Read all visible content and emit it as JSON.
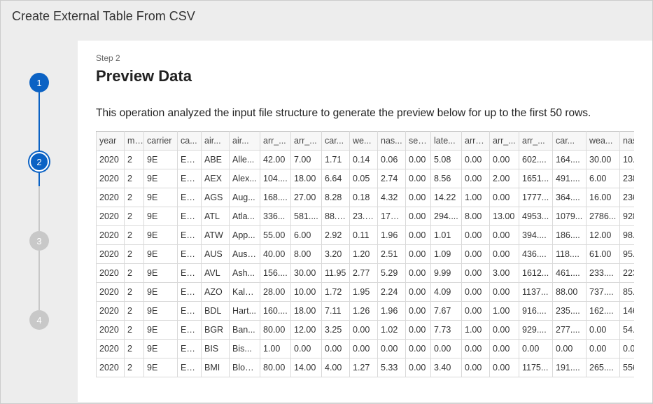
{
  "window": {
    "title": "Create External Table From CSV"
  },
  "stepper": {
    "steps": [
      {
        "num": "1",
        "state": "done"
      },
      {
        "num": "2",
        "state": "current"
      },
      {
        "num": "3",
        "state": "future"
      },
      {
        "num": "4",
        "state": "future"
      }
    ]
  },
  "content": {
    "step_label": "Step 2",
    "title": "Preview Data",
    "description": "This operation analyzed the input file structure to generate the preview below for up to the first 50 rows."
  },
  "table": {
    "columns": [
      "year",
      "m...",
      "carrier",
      "ca...",
      "air...",
      "air...",
      "arr_...",
      "arr_...",
      "car...",
      "we...",
      "nas...",
      "sec...",
      "late...",
      "arr_...",
      "arr_...",
      "arr_...",
      "car...",
      "wea...",
      "nas"
    ],
    "rows": [
      [
        "2020",
        "2",
        "9E",
        "En...",
        "ABE",
        "Alle...",
        "42.00",
        "7.00",
        "1.71",
        "0.14",
        "0.06",
        "0.00",
        "5.08",
        "0.00",
        "0.00",
        "602....",
        "164....",
        "30.00",
        "10."
      ],
      [
        "2020",
        "2",
        "9E",
        "En...",
        "AEX",
        "Alex...",
        "104....",
        "18.00",
        "6.64",
        "0.05",
        "2.74",
        "0.00",
        "8.56",
        "0.00",
        "2.00",
        "1651...",
        "491....",
        "6.00",
        "238"
      ],
      [
        "2020",
        "2",
        "9E",
        "En...",
        "AGS",
        "Aug...",
        "168....",
        "27.00",
        "8.28",
        "0.18",
        "4.32",
        "0.00",
        "14.22",
        "1.00",
        "0.00",
        "1777...",
        "364....",
        "16.00",
        "236"
      ],
      [
        "2020",
        "2",
        "9E",
        "En...",
        "ATL",
        "Atla...",
        "336...",
        "581....",
        "88.22",
        "23.66",
        "174....",
        "0.00",
        "294....",
        "8.00",
        "13.00",
        "4953...",
        "1079...",
        "2786...",
        "928"
      ],
      [
        "2020",
        "2",
        "9E",
        "En...",
        "ATW",
        "App...",
        "55.00",
        "6.00",
        "2.92",
        "0.11",
        "1.96",
        "0.00",
        "1.01",
        "0.00",
        "0.00",
        "394....",
        "186....",
        "12.00",
        "98."
      ],
      [
        "2020",
        "2",
        "9E",
        "En...",
        "AUS",
        "Aust...",
        "40.00",
        "8.00",
        "3.20",
        "1.20",
        "2.51",
        "0.00",
        "1.09",
        "0.00",
        "0.00",
        "436....",
        "118....",
        "61.00",
        "95."
      ],
      [
        "2020",
        "2",
        "9E",
        "En...",
        "AVL",
        "Ash...",
        "156....",
        "30.00",
        "11.95",
        "2.77",
        "5.29",
        "0.00",
        "9.99",
        "0.00",
        "3.00",
        "1612...",
        "461....",
        "233....",
        "223"
      ],
      [
        "2020",
        "2",
        "9E",
        "En...",
        "AZO",
        "Kala...",
        "28.00",
        "10.00",
        "1.72",
        "1.95",
        "2.24",
        "0.00",
        "4.09",
        "0.00",
        "0.00",
        "1137...",
        "88.00",
        "737....",
        "85."
      ],
      [
        "2020",
        "2",
        "9E",
        "En...",
        "BDL",
        "Hart...",
        "160....",
        "18.00",
        "7.11",
        "1.26",
        "1.96",
        "0.00",
        "7.67",
        "0.00",
        "1.00",
        "916....",
        "235....",
        "162....",
        "146"
      ],
      [
        "2020",
        "2",
        "9E",
        "En...",
        "BGR",
        "Ban...",
        "80.00",
        "12.00",
        "3.25",
        "0.00",
        "1.02",
        "0.00",
        "7.73",
        "1.00",
        "0.00",
        "929....",
        "277....",
        "0.00",
        "54."
      ],
      [
        "2020",
        "2",
        "9E",
        "En...",
        "BIS",
        "Bis...",
        "1.00",
        "0.00",
        "0.00",
        "0.00",
        "0.00",
        "0.00",
        "0.00",
        "0.00",
        "0.00",
        "0.00",
        "0.00",
        "0.00",
        "0.0"
      ],
      [
        "2020",
        "2",
        "9E",
        "En...",
        "BMI",
        "Bloo...",
        "80.00",
        "14.00",
        "4.00",
        "1.27",
        "5.33",
        "0.00",
        "3.40",
        "0.00",
        "0.00",
        "1175...",
        "191....",
        "265....",
        "556"
      ]
    ]
  }
}
